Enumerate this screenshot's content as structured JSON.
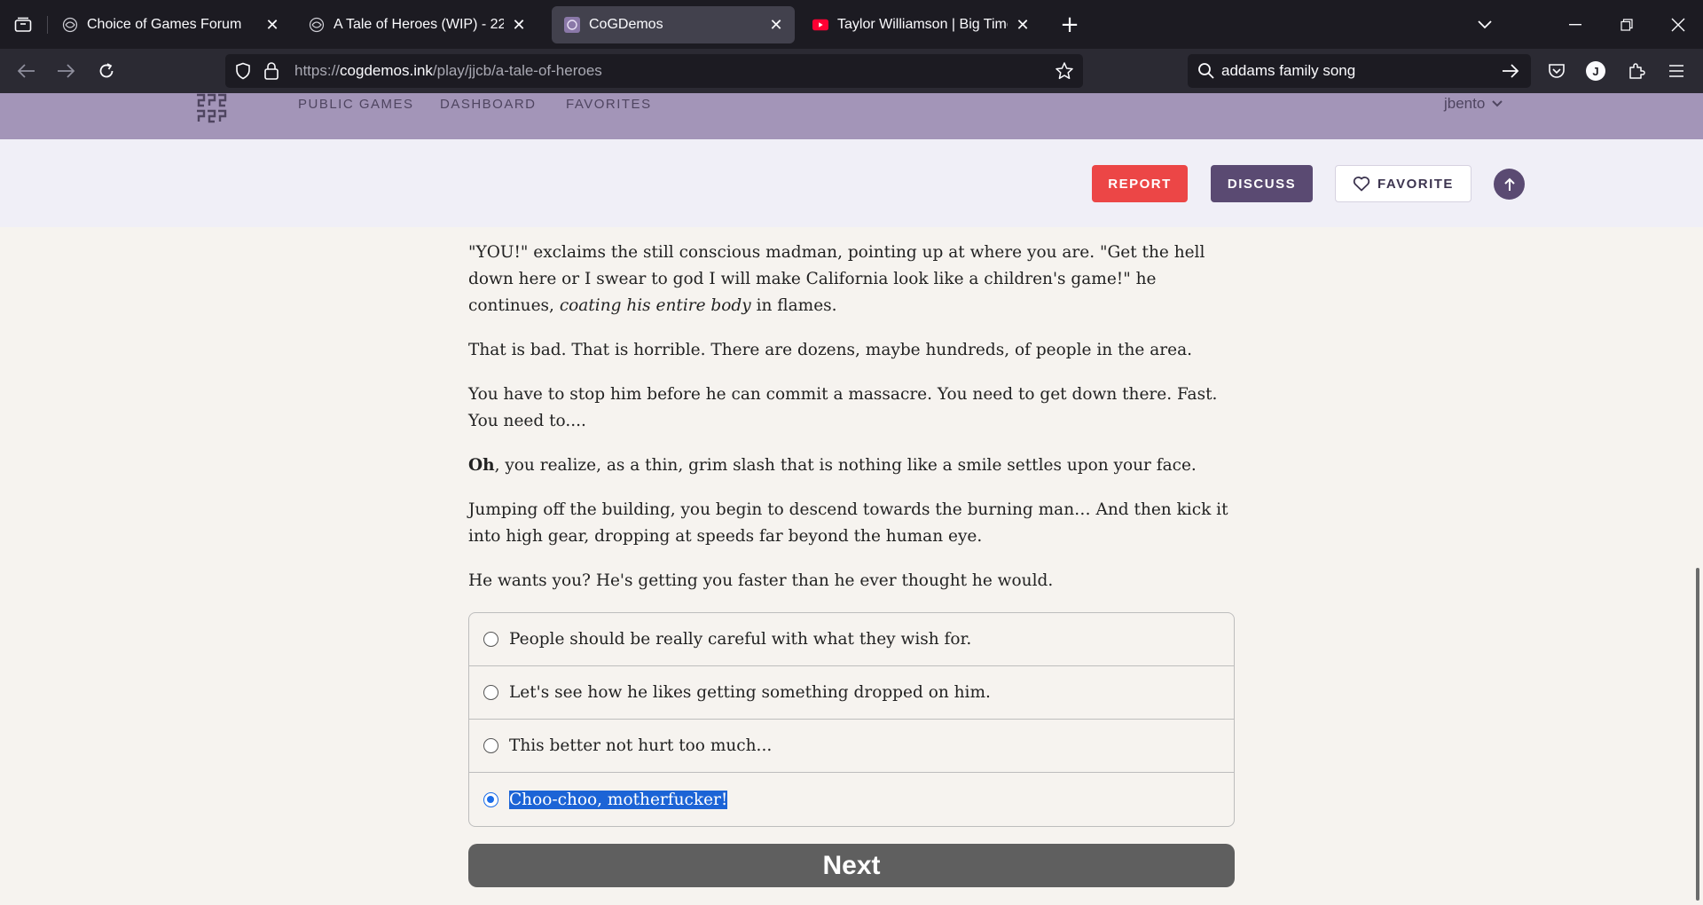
{
  "browser": {
    "tabs": [
      {
        "title": "Choice of Games Forum",
        "active": false
      },
      {
        "title": "A Tale of Heroes (WIP) - 224k w",
        "active": false
      },
      {
        "title": "CoGDemos",
        "active": true
      },
      {
        "title": "Taylor Williamson | Big Time Ce",
        "active": false
      }
    ],
    "url_prefix": "https://",
    "url_host": "cogdemos.ink",
    "url_path": "/play/jjcb/a-tale-of-heroes",
    "search_value": "addams family song",
    "profile_initial": "J"
  },
  "site": {
    "nav": [
      "PUBLIC GAMES",
      "DASHBOARD",
      "FAVORITES"
    ],
    "username": "jbento",
    "actions": {
      "report": "REPORT",
      "discuss": "DISCUSS",
      "favorite": "FAVORITE"
    }
  },
  "story": {
    "p1_a": "\"YOU!\" exclaims the still conscious madman, pointing up at where you are. \"Get the hell down here or I swear to god I will make California look like a children's game!\" he continues, ",
    "p1_em": "coating his entire body",
    "p1_b": " in flames.",
    "p2": "That is bad. That is horrible. There are dozens, maybe hundreds, of people in the area.",
    "p3": "You have to stop him before he can commit a massacre. You need to get down there. Fast. You need to....",
    "p4_strong": "Oh",
    "p4_rest": ", you realize, as a thin, grim slash that is nothing like a smile settles upon your face.",
    "p5": "Jumping off the building, you begin to descend towards the burning man… And then kick it into high gear, dropping at speeds far beyond the human eye.",
    "p6": "He wants you? He's getting you faster than he ever thought he would."
  },
  "choices": [
    {
      "label": "People should be really careful with what they wish for.",
      "selected": false
    },
    {
      "label": "Let's see how he likes getting something dropped on him.",
      "selected": false
    },
    {
      "label": "This better not hurt too much...",
      "selected": false
    },
    {
      "label": "Choo-choo, motherfucker!",
      "selected": true
    }
  ],
  "next_label": "Next"
}
